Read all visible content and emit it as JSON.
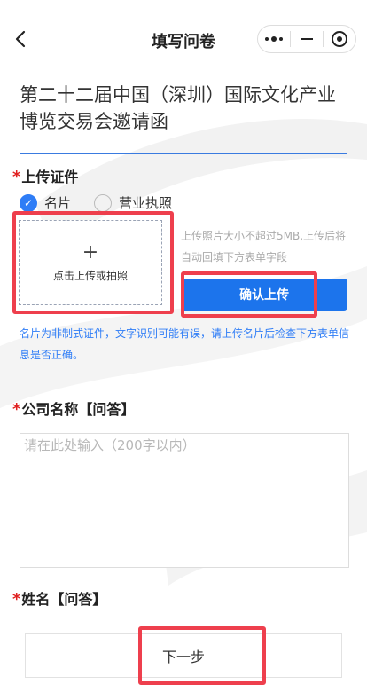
{
  "nav": {
    "title": "填写问卷",
    "back_icon": "chevron-left-icon",
    "more_icon": "more-dots-icon",
    "minimize_icon": "minimize-icon",
    "close_icon": "target-circle-icon"
  },
  "form": {
    "title": "第二十二届中国（深圳）国际文化产业博览交易会邀请函"
  },
  "upload": {
    "required_mark": "*",
    "label": "上传证件",
    "options": [
      {
        "label": "名片",
        "checked": true
      },
      {
        "label": "营业执照",
        "checked": false
      }
    ],
    "box_label": "点击上传或拍照",
    "hint": "上传照片大小不超过5MB,上传后将自动回填下方表单字段",
    "confirm_label": "确认上传",
    "note": "名片为非制式证件，文字识别可能有误，请上传名片后检查下方表单信息是否正确。"
  },
  "company": {
    "required_mark": "*",
    "label": "公司名称【问答】",
    "placeholder": "请在此处输入（200字以内）",
    "value": ""
  },
  "name_field": {
    "required_mark": "*",
    "label": "姓名【问答】"
  },
  "footer": {
    "next_label": "下一步"
  },
  "colors": {
    "accent": "#1c74ec",
    "required": "#e02020",
    "highlight": "#ee3f4d"
  }
}
